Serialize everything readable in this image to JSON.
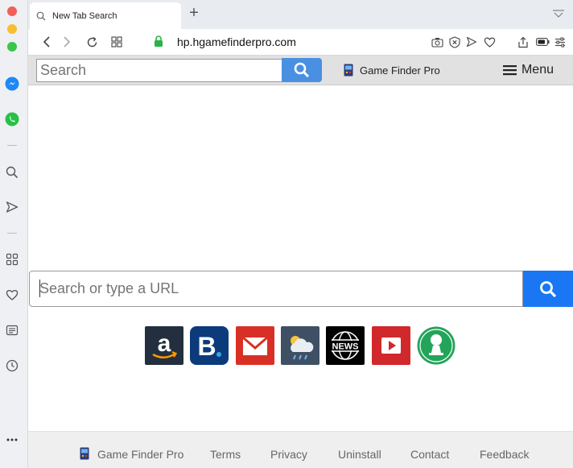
{
  "browser": {
    "tab_title": "New Tab Search",
    "url": "hp.hgamefinderpro.com"
  },
  "header": {
    "search_placeholder": "Search",
    "brand": "Game Finder Pro",
    "menu_label": "Menu"
  },
  "main": {
    "search_placeholder": "Search or type a URL",
    "tiles": [
      {
        "name": "amazon",
        "icon": "amazon-icon",
        "color": "#232f3e"
      },
      {
        "name": "booking",
        "icon": "booking-icon",
        "color": "#0c3b7c"
      },
      {
        "name": "gmail",
        "icon": "mail-icon",
        "color": "#d93025"
      },
      {
        "name": "weather",
        "icon": "weather-icon",
        "color": "#3f5064"
      },
      {
        "name": "news",
        "icon": "news-icon",
        "color": "#000000",
        "label": "NEWS"
      },
      {
        "name": "youtube",
        "icon": "play-icon",
        "color": "#d0282b"
      },
      {
        "name": "games",
        "icon": "pawn-icon",
        "color": "#22a55a"
      }
    ]
  },
  "footer": {
    "brand": "Game Finder Pro",
    "links": [
      "Terms",
      "Privacy",
      "Uninstall",
      "Contact",
      "Feedback"
    ]
  },
  "colors": {
    "search_button": "#4a90e2",
    "main_search_button": "#1977f3",
    "header_bg": "#e1e1e1"
  }
}
